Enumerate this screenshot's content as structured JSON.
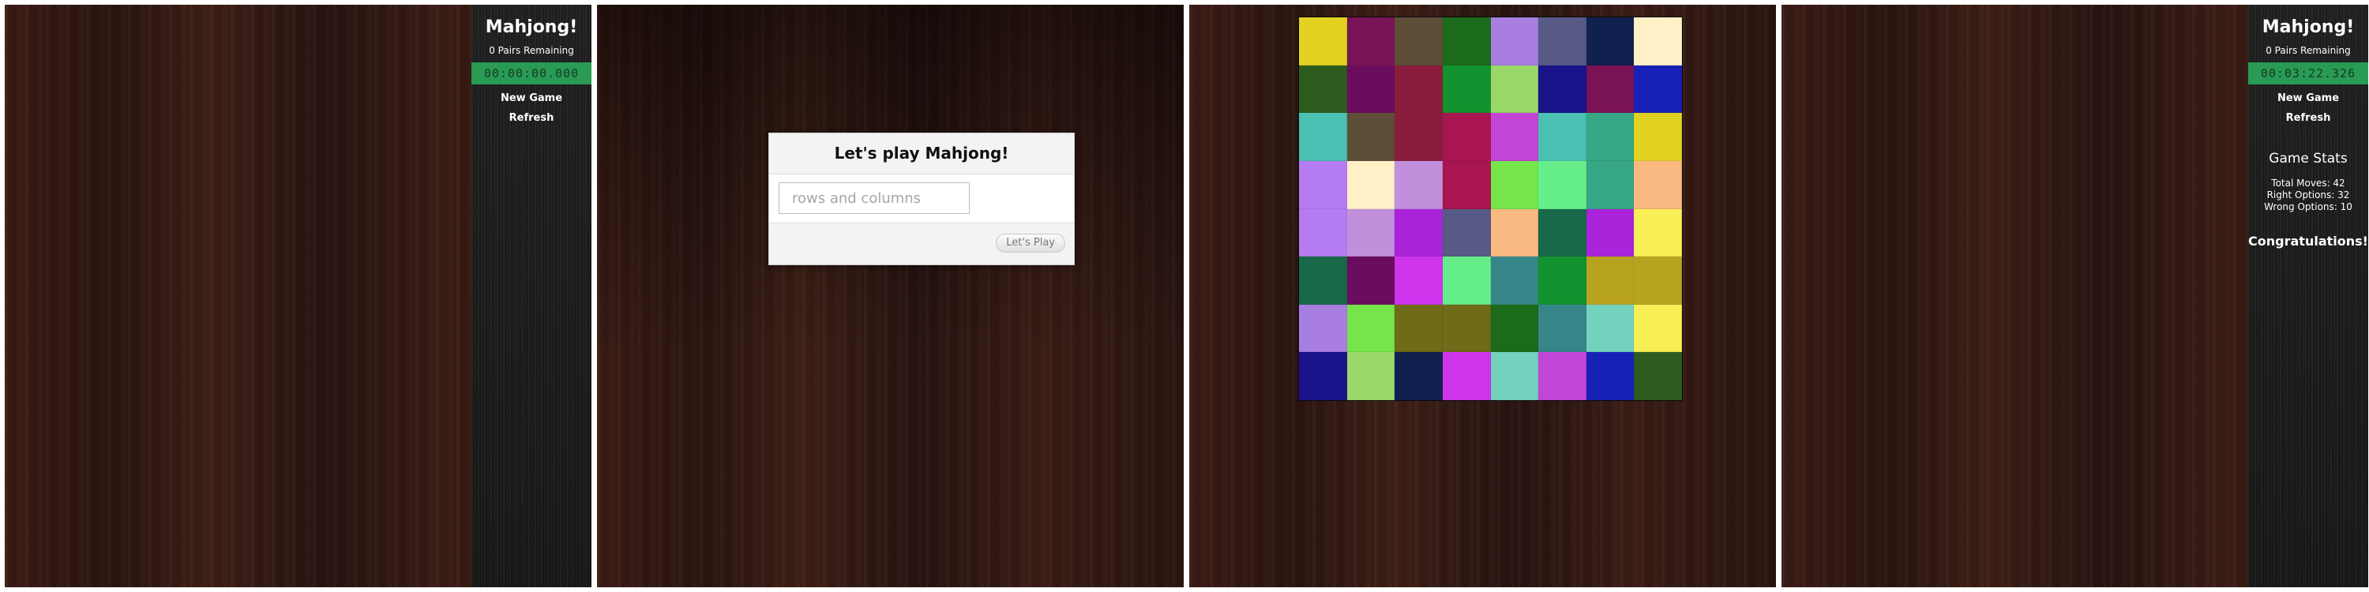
{
  "panel1": {
    "sidebar": {
      "title": "Mahjong!",
      "pairs_remaining": "0 Pairs Remaining",
      "timer": "00:00:00.000",
      "new_game": "New Game",
      "refresh": "Refresh"
    }
  },
  "panel2": {
    "dialog": {
      "title": "Let's play Mahjong!",
      "input_placeholder": "rows and columns",
      "input_value": "",
      "button_label": "Let's Play"
    }
  },
  "panel3": {
    "board": {
      "tiles": [
        [
          "#e2d121",
          "#7a1256",
          "#5e4e38",
          "#1b6b1b",
          "#a87ee0",
          "#575a84",
          "#11214f",
          "#fff0c8"
        ],
        [
          "#2d5c1f",
          "#6b0d5f",
          "#8a1d3c",
          "#12932f",
          "#9ad86a",
          "#1b1389",
          "#7a1256",
          "#1821b7"
        ],
        [
          "#4ac1b2",
          "#5e4e38",
          "#8a1d3c",
          "#a81551",
          "#c146d6",
          "#4ac1b2",
          "#38a785",
          "#e2d121"
        ],
        [
          "#b57cf2",
          "#fff0c8",
          "#c28fdd",
          "#a81551",
          "#75e54a",
          "#66ee8b",
          "#38a785",
          "#fbb982"
        ],
        [
          "#b57cf2",
          "#c28fdd",
          "#a924d8",
          "#575a84",
          "#fbb982",
          "#18684a",
          "#a924d8",
          "#f8ee55"
        ],
        [
          "#18684a",
          "#6b0d5f",
          "#cf34ed",
          "#66ee8b",
          "#368689",
          "#12932f",
          "#b8a321",
          "#b8a321"
        ],
        [
          "#a87ee0",
          "#75e54a",
          "#6f6b18",
          "#6f6b18",
          "#1b6b1b",
          "#368689",
          "#73d2bd",
          "#f8ee55"
        ],
        [
          "#1b1389",
          "#9ad86a",
          "#11214f",
          "#cf34ed",
          "#73d2bd",
          "#c146d6",
          "#1821b7",
          "#2d5c1f"
        ]
      ]
    }
  },
  "panel4": {
    "sidebar": {
      "title": "Mahjong!",
      "pairs_remaining": "0 Pairs Remaining",
      "timer": "00:03:22.326",
      "new_game": "New Game",
      "refresh": "Refresh",
      "stats_title": "Game Stats",
      "total_moves": "Total Moves: 42",
      "right_options": "Right Options: 32",
      "wrong_options": "Wrong Options: 10",
      "congrats": "Congratulations!"
    }
  }
}
